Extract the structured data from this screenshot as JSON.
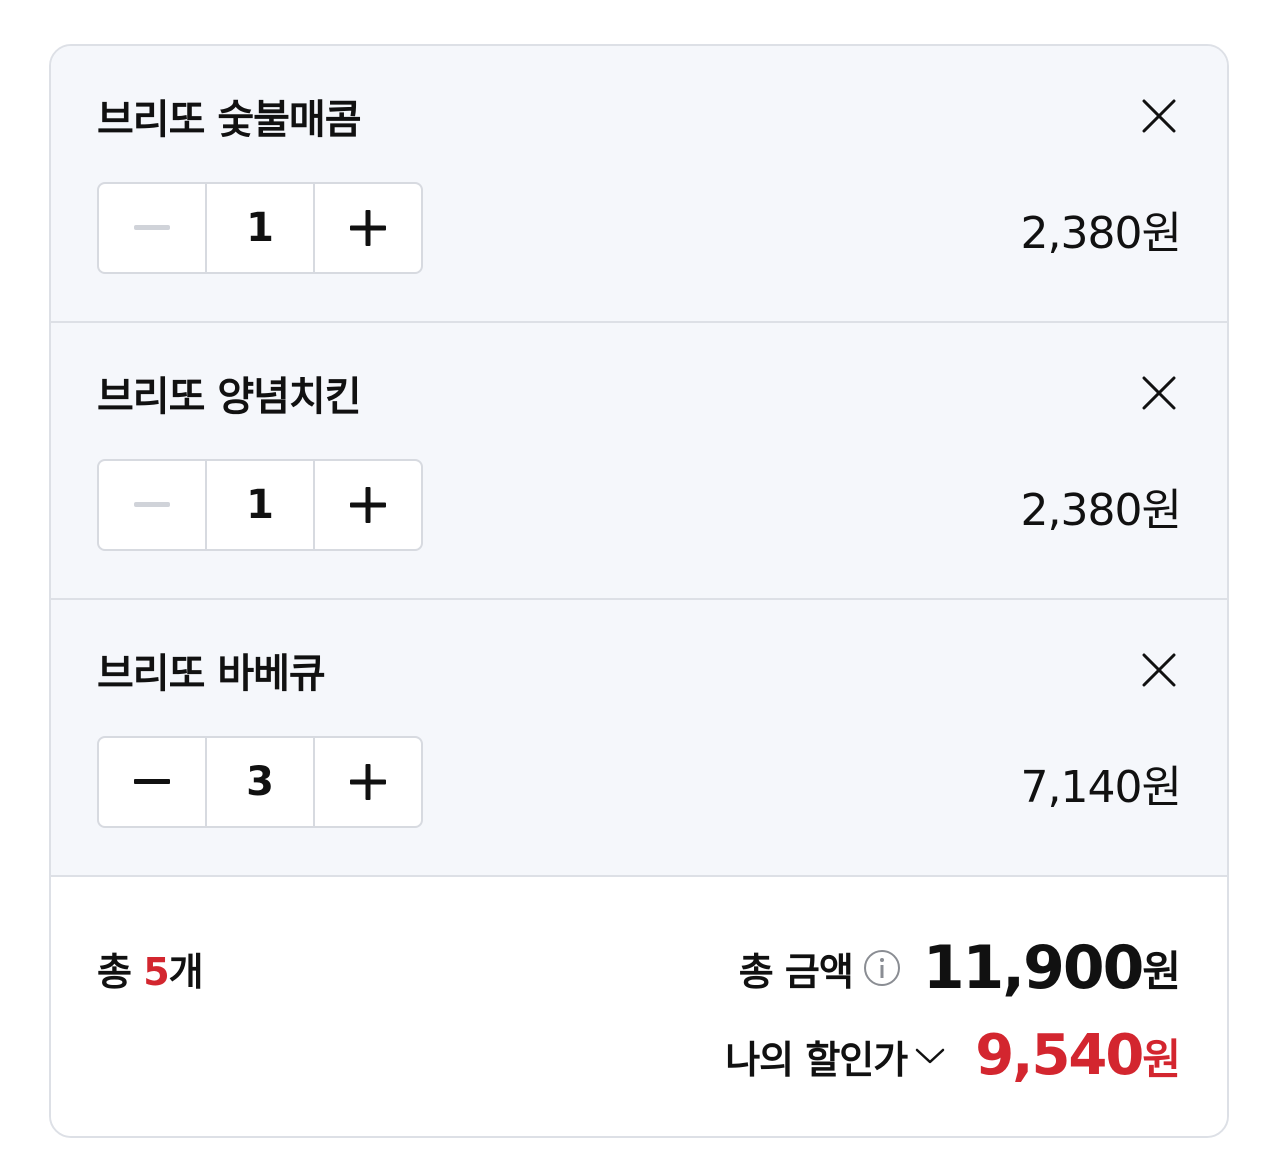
{
  "items": [
    {
      "name": "브리또 숯불매콤",
      "quantity": "1",
      "price": "2,380원",
      "minus_enabled": false
    },
    {
      "name": "브리또 양념치킨",
      "quantity": "1",
      "price": "2,380원",
      "minus_enabled": false
    },
    {
      "name": "브리또 바베큐",
      "quantity": "3",
      "price": "7,140원",
      "minus_enabled": true
    }
  ],
  "summary": {
    "count_prefix": "총 ",
    "count_value": "5",
    "count_suffix": "개",
    "total_label": "총 금액",
    "total_amount": "11,900",
    "total_unit": "원",
    "discount_label": "나의 할인가",
    "discount_amount": "9,540",
    "discount_unit": "원"
  },
  "colors": {
    "accent": "#d3262f",
    "item_background": "#f5f7fb",
    "border": "#dde0e6",
    "minus_disabled": "#d0d3d9",
    "text": "#111111"
  },
  "icons": {
    "remove": "close-icon",
    "decrease": "minus-icon",
    "increase": "plus-icon",
    "info": "info-icon",
    "expand": "chevron-down-icon"
  }
}
